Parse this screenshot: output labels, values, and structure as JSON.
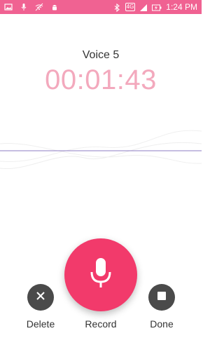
{
  "status_bar": {
    "time": "1:24 PM",
    "network_type": "4G",
    "icons": [
      "gallery-icon",
      "microphone-icon",
      "wifi-off-icon",
      "android-icon",
      "bluetooth-icon",
      "lte-icon",
      "signal-icon",
      "battery-icon"
    ],
    "colors": {
      "background": "#f06292",
      "foreground": "#ffffff"
    }
  },
  "recording": {
    "title": "Voice 5",
    "elapsed": "00:01:43"
  },
  "controls": {
    "delete_label": "Delete",
    "record_label": "Record",
    "done_label": "Done"
  },
  "colors": {
    "accent": "#f23a6b",
    "timer": "#f3a9bd",
    "secondary_button": "#4a4a4a"
  }
}
